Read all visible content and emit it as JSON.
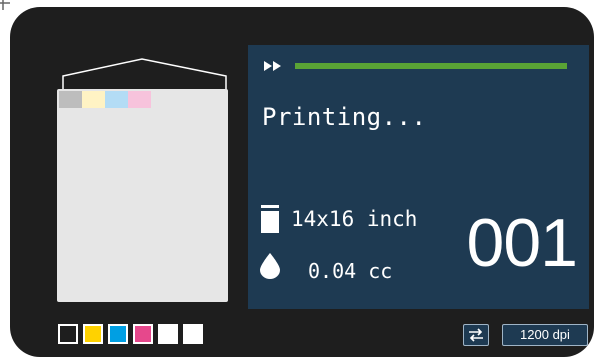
{
  "screen": {
    "status": "Printing...",
    "media_size": "14x16 inch",
    "ink_volume": "0.04 cc",
    "copy_counter": "001",
    "progress": 1.0
  },
  "controls": {
    "resolution_label": "1200 dpi"
  },
  "ink_cartridges": [
    {
      "color": "#1e1e1e"
    },
    {
      "color": "#ffd200"
    },
    {
      "color": "#009fe3"
    },
    {
      "color": "#e6488c"
    },
    {
      "color": "#ffffff"
    },
    {
      "color": "#ffffff"
    }
  ],
  "sheet_swatches": [
    "#bdbdbd",
    "#fff3c4",
    "#b3dcf5",
    "#f7c3dc"
  ],
  "colors": {
    "device_body": "#1e1e1e",
    "screen_bg": "#1e3a52",
    "progress": "#5aa335",
    "sheet": "#e6e6e6"
  },
  "icons": {
    "fast_forward": "fast-forward-icon",
    "paper": "paper-icon",
    "ink_drop": "ink-drop-icon",
    "swap": "swap-icon"
  }
}
